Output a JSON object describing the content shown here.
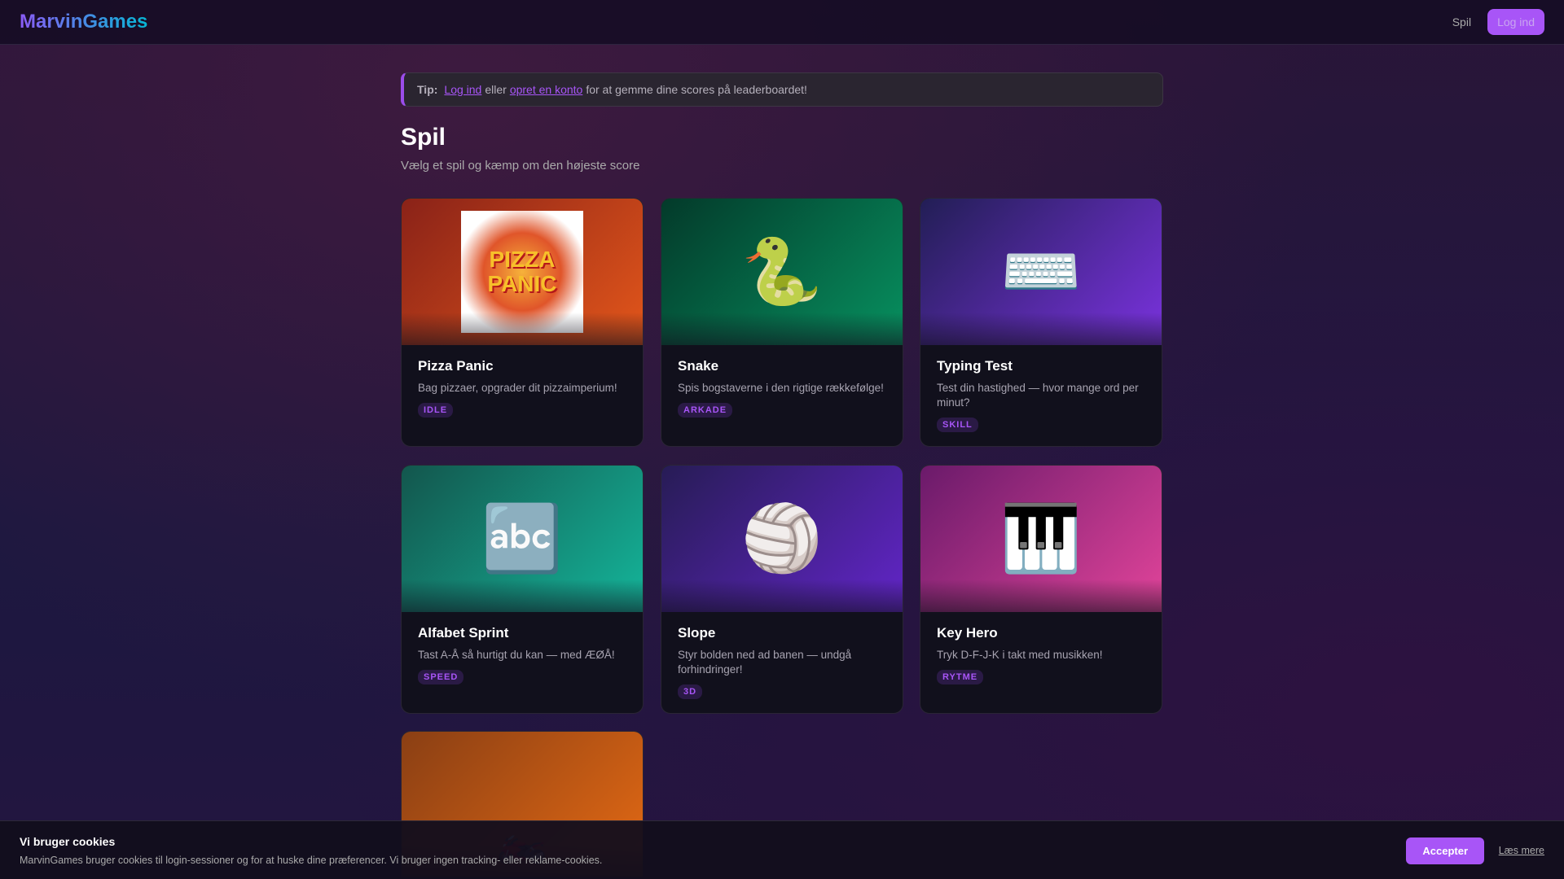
{
  "header": {
    "logo": "MarvinGames",
    "nav_games": "Spil",
    "login": "Log ind"
  },
  "tip": {
    "label": "Tip:",
    "login_link": "Log ind",
    "middle": "eller",
    "signup_link": "opret en konto",
    "rest": "for at gemme dine scores på leaderboardet!"
  },
  "page": {
    "title": "Spil",
    "subtitle": "Vælg et spil og kæmp om den højeste score"
  },
  "games": [
    {
      "title": "Pizza Panic",
      "desc": "Bag pizzaer, opgrader dit pizzaimperium!",
      "tag": "IDLE",
      "art": "PIZZA PANIC"
    },
    {
      "title": "Snake",
      "desc": "Spis bogstaverne i den rigtige rækkefølge!",
      "tag": "ARKADE",
      "icon": "🐍"
    },
    {
      "title": "Typing Test",
      "desc": "Test din hastighed — hvor mange ord per minut?",
      "tag": "SKILL",
      "icon": "⌨️"
    },
    {
      "title": "Alfabet Sprint",
      "desc": "Tast A-Å så hurtigt du kan — med ÆØÅ!",
      "tag": "SPEED",
      "icon": "🔤"
    },
    {
      "title": "Slope",
      "desc": "Styr bolden ned ad banen — undgå forhindringer!",
      "tag": "3D",
      "icon": "🏐"
    },
    {
      "title": "Key Hero",
      "desc": "Tryk D-F-J-K i takt med musikken!",
      "tag": "RYTME",
      "icon": "🎹"
    },
    {
      "icon": "🏍️"
    }
  ],
  "cookie": {
    "title": "Vi bruger cookies",
    "text": "MarvinGames bruger cookies til login-sessioner og for at huske dine præferencer. Vi bruger ingen tracking- eller reklame-cookies.",
    "accept": "Accepter",
    "more": "Læs mere"
  }
}
